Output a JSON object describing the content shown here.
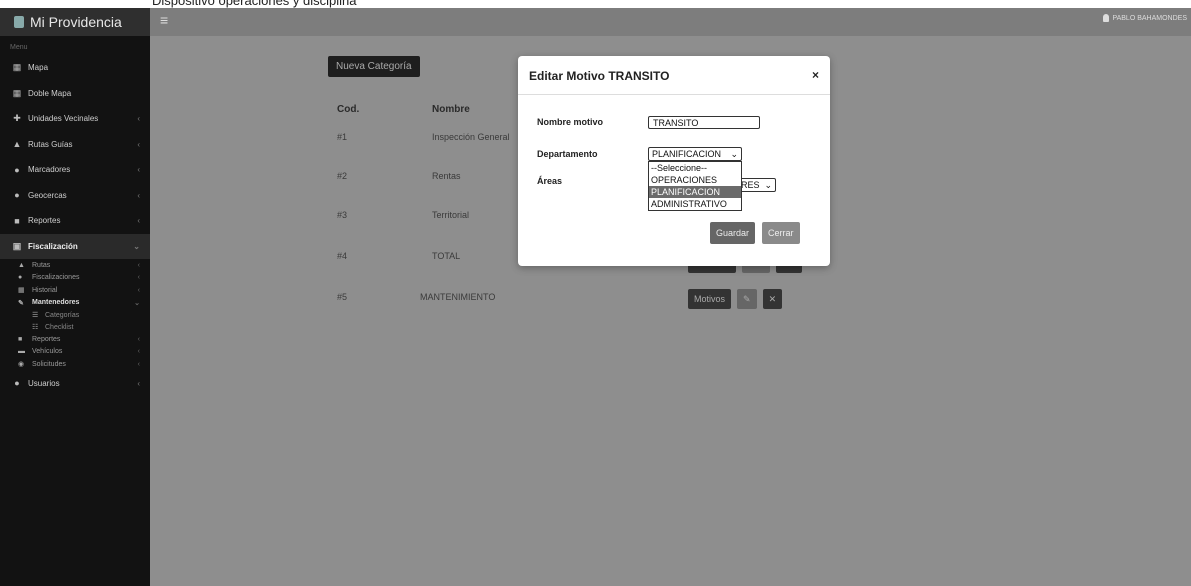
{
  "top_caption": "Dispositivo operaciones y disciplina",
  "app": {
    "brand": "Mi Providencia",
    "user": "PABLO BAHAMONDES"
  },
  "sidebar": {
    "header": "Menu",
    "items": [
      {
        "label": "Mapa",
        "icon": "map-icon",
        "chevron": false
      },
      {
        "label": "Doble Mapa",
        "icon": "double-map-icon",
        "chevron": false
      },
      {
        "label": "Unidades Vecinales",
        "icon": "units-icon",
        "chevron": true
      },
      {
        "label": "Rutas Guías",
        "icon": "routes-icon",
        "chevron": true
      },
      {
        "label": "Marcadores",
        "icon": "marker-icon",
        "chevron": true
      },
      {
        "label": "Geocercas",
        "icon": "geofence-icon",
        "chevron": true
      },
      {
        "label": "Reportes",
        "icon": "report-icon",
        "chevron": true
      },
      {
        "label": "Fiscalización",
        "icon": "inspection-icon",
        "chevron": true,
        "active": true
      }
    ],
    "subitems": [
      {
        "label": "Rutas",
        "icon": "route-icon"
      },
      {
        "label": "Fiscalizaciones",
        "icon": "user-check-icon"
      },
      {
        "label": "Historial",
        "icon": "history-icon"
      },
      {
        "label": "Mantenedores",
        "icon": "wrench-icon",
        "bold": true
      }
    ],
    "subsub": [
      {
        "label": "Categorías",
        "icon": "list-icon"
      },
      {
        "label": "Checklist",
        "icon": "checklist-icon"
      }
    ],
    "subitems2": [
      {
        "label": "Reportes",
        "icon": "report-icon"
      },
      {
        "label": "Vehículos",
        "icon": "car-icon"
      },
      {
        "label": "Solicitudes",
        "icon": "request-icon"
      }
    ],
    "last_item": {
      "label": "Usuarios",
      "icon": "users-icon"
    }
  },
  "main": {
    "new_button": "Nueva Categoría",
    "col_cod": "Cod.",
    "col_nombre": "Nombre",
    "rows": [
      {
        "cod": "#1",
        "nombre": "Inspección General"
      },
      {
        "cod": "#2",
        "nombre": "Rentas"
      },
      {
        "cod": "#3",
        "nombre": "Territorial"
      },
      {
        "cod": "#4",
        "nombre": "TOTAL"
      },
      {
        "cod": "#5",
        "nombre": "MANTENIMIENTO"
      }
    ],
    "motivos_label": "Motivos"
  },
  "modal": {
    "title": "Editar Motivo TRANSITO",
    "close": "×",
    "nombre_label": "Nombre motivo",
    "nombre_value": "TRANSITO",
    "departamento_label": "Departamento",
    "departamento_value": "PLANIFICACION",
    "areas_label": "Áreas",
    "areas_value": "ORES",
    "options": [
      "--Seleccione--",
      "OPERACIONES",
      "PLANIFICACION",
      "ADMINISTRATIVO"
    ],
    "highlighted_option": "PLANIFICACION",
    "guardar": "Guardar",
    "cerrar": "Cerrar"
  }
}
